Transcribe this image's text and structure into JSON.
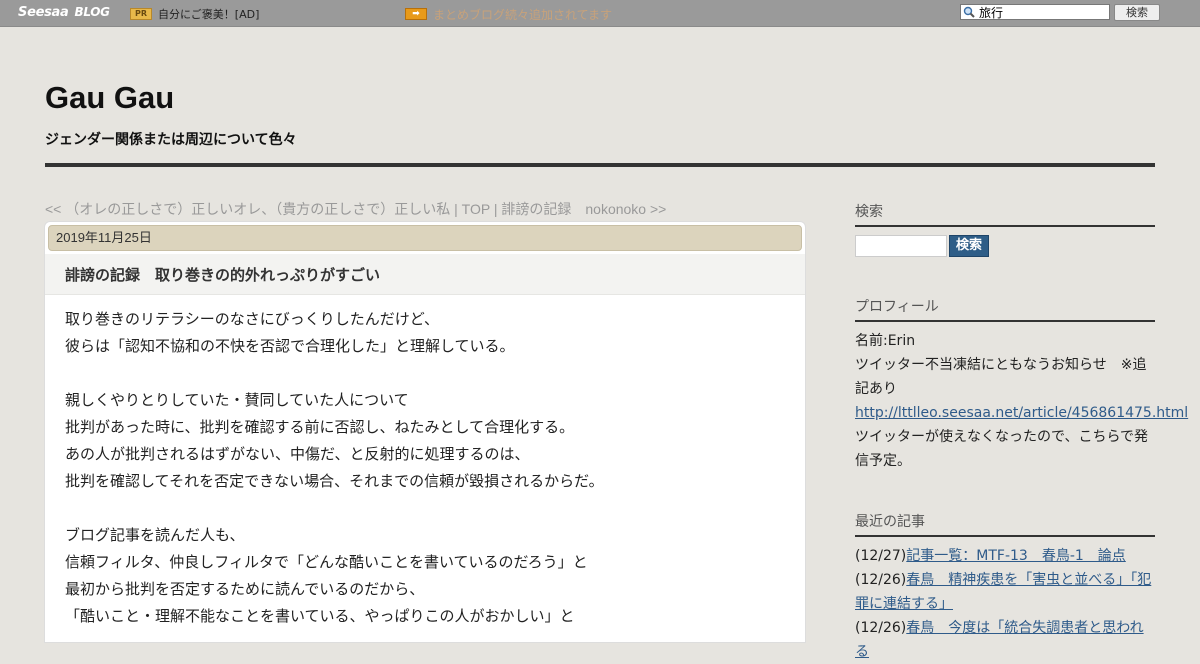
{
  "topbar": {
    "logo_main": "Seesaa",
    "logo_sub": "BLOG",
    "pr_badge": "PR",
    "ad_text": "自分にご褒美！[AD]",
    "notice_icon": "➡",
    "notice_text": "まとめブログ続々追加されてます",
    "search_value": "旅行",
    "search_button": "検索"
  },
  "header": {
    "title": "Gau Gau",
    "description": "ジェンダー関係または周辺について色々"
  },
  "post_nav": {
    "prev": "<< （オレの正しさで）正しいオレ、（貴方の正しさで）正しい私",
    "sep1": " | ",
    "top": "TOP",
    "sep2": " | ",
    "next": "誹謗の記録　nokonoko >>"
  },
  "article": {
    "date": "2019年11月25日",
    "title": "誹謗の記録　取り巻きの的外れっぷりがすごい",
    "lines": [
      "取り巻きのリテラシーのなさにびっくりしたんだけど、",
      "彼らは「認知不協和の不快を否認で合理化した」と理解している。",
      "",
      "親しくやりとりしていた・賛同していた人について",
      "批判があった時に、批判を確認する前に否認し、ねたみとして合理化する。",
      "あの人が批判されるはずがない、中傷だ、と反射的に処理するのは、",
      "批判を確認してそれを否定できない場合、それまでの信頼が毀損されるからだ。",
      "",
      "ブログ記事を読んだ人も、",
      "信頼フィルタ、仲良しフィルタで「どんな酷いことを書いているのだろう」と",
      "最初から批判を否定するために読んでいるのだから、",
      "「酷いこと・理解不能なことを書いている、やっぱりこの人がおかしい」と"
    ]
  },
  "sidebar": {
    "search_heading": "検索",
    "search_button": "検索",
    "profile_heading": "プロフィール",
    "profile_name": "名前:Erin",
    "profile_line1": "ツイッター不当凍結にともなうお知らせ　※追記あり",
    "profile_link": "http://lttlleo.seesaa.net/article/456861475.html",
    "profile_line2": "ツイッターが使えなくなったので、こちらで発信予定。",
    "recent_heading": "最近の記事",
    "recent": [
      {
        "date": "(12/27)",
        "title": "記事一覧：MTF-13　春鳥-1　論点"
      },
      {
        "date": "(12/26)",
        "title": "春鳥　精神疾患を「害虫と並べる」「犯罪に連結する」"
      },
      {
        "date": "(12/26)",
        "title": "春鳥　今度は「統合失調患者と思われる"
      }
    ]
  }
}
